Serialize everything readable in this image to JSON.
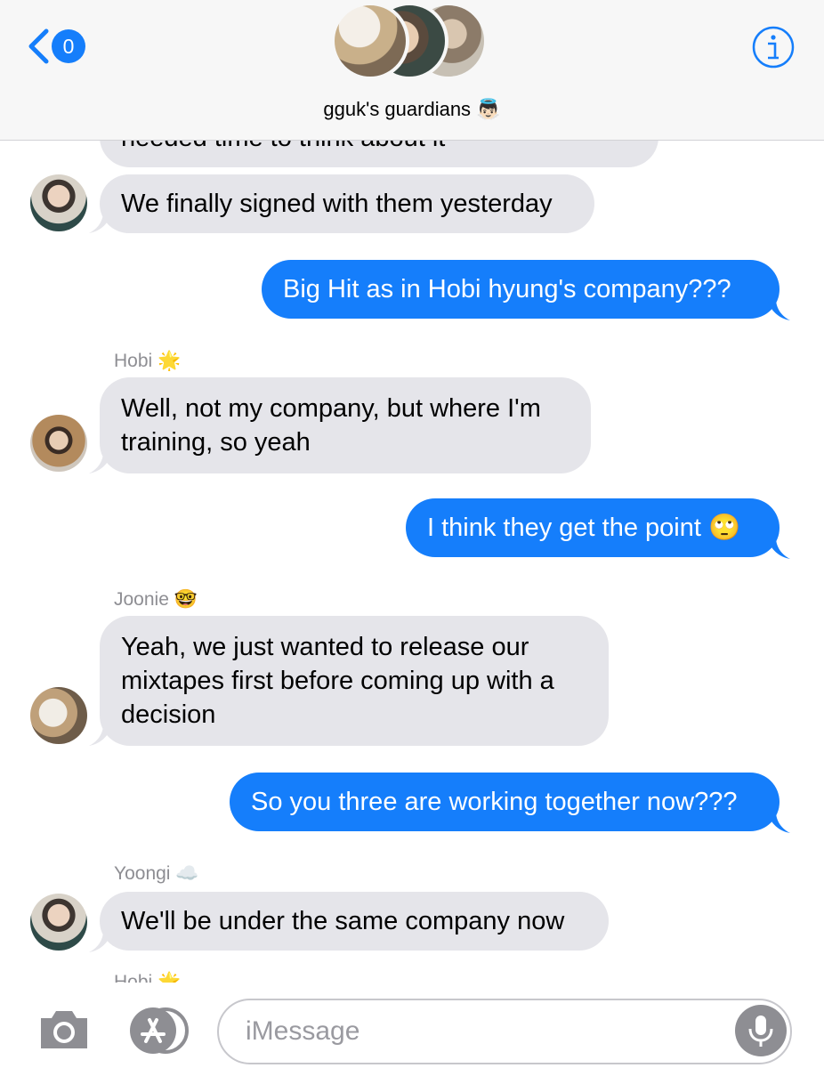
{
  "header": {
    "back_badge": "0",
    "group_title": "gguk's guardians",
    "group_emoji": "👼🏻"
  },
  "thread": {
    "partial_top_text": "needed time to think about it",
    "messages": [
      {
        "sender": "",
        "direction": "in",
        "text": "We finally signed with them yesterday"
      },
      {
        "sender": "",
        "direction": "out",
        "text": "Big Hit as in Hobi hyung's company???"
      },
      {
        "sender": "Hobi",
        "sender_emoji": "🌟",
        "direction": "in",
        "text": "Well, not my company, but where I'm training, so yeah"
      },
      {
        "sender": "",
        "direction": "out",
        "text": "I think they get the point 🙄"
      },
      {
        "sender": "Joonie",
        "sender_emoji": "🤓",
        "direction": "in",
        "text": "Yeah, we just wanted to release our mixtapes first before coming up with a decision"
      },
      {
        "sender": "",
        "direction": "out",
        "text": "So you three are working together now???"
      },
      {
        "sender": "Yoongi",
        "sender_emoji": "☁️",
        "direction": "in",
        "text": "We'll be under the same company now"
      }
    ],
    "partial_bottom_sender": "Hobi 🌟"
  },
  "input": {
    "placeholder": "iMessage"
  },
  "icons": {
    "back": "chevron-left-icon",
    "info": "info-icon",
    "camera": "camera-icon",
    "apps": "app-store-icon",
    "mic": "microphone-icon"
  },
  "colors": {
    "accent": "#157efb",
    "incoming_bubble": "#e5e5ea",
    "header_bg": "#f7f7f7"
  }
}
